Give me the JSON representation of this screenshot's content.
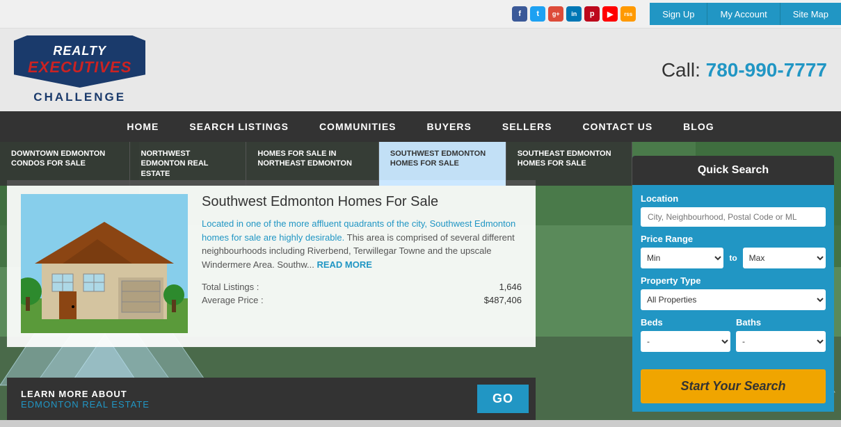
{
  "topbar": {
    "social": [
      {
        "name": "facebook",
        "label": "f",
        "class": "si-fb"
      },
      {
        "name": "twitter",
        "label": "t",
        "class": "si-tw"
      },
      {
        "name": "google-plus",
        "label": "g+",
        "class": "si-gp"
      },
      {
        "name": "linkedin",
        "label": "in",
        "class": "si-li"
      },
      {
        "name": "pinterest",
        "label": "p",
        "class": "si-pi"
      },
      {
        "name": "youtube",
        "label": "▶",
        "class": "si-yt"
      },
      {
        "name": "rss",
        "label": "rss",
        "class": "si-rss"
      }
    ],
    "links": [
      {
        "label": "Sign Up",
        "name": "sign-up"
      },
      {
        "label": "My Account",
        "name": "my-account"
      },
      {
        "label": "Site Map",
        "name": "site-map"
      }
    ]
  },
  "header": {
    "logo": {
      "line1": "REALTY",
      "line2": "EXECUTIVES",
      "line3": "CHALLENGE"
    },
    "call_label": "Call:",
    "call_number": "780-990-7777"
  },
  "nav": {
    "items": [
      {
        "label": "HOME",
        "name": "nav-home"
      },
      {
        "label": "SEARCH LISTINGS",
        "name": "nav-search-listings"
      },
      {
        "label": "COMMUNITIES",
        "name": "nav-communities"
      },
      {
        "label": "BUYERS",
        "name": "nav-buyers"
      },
      {
        "label": "SELLERS",
        "name": "nav-sellers"
      },
      {
        "label": "CONTACT US",
        "name": "nav-contact"
      },
      {
        "label": "BLOG",
        "name": "nav-blog"
      }
    ]
  },
  "subnav": {
    "items": [
      {
        "label": "DOWNTOWN EDMONTON CONDOS FOR SALE",
        "active": false,
        "name": "subnav-downtown"
      },
      {
        "label": "NORTHWEST EDMONTON REAL ESTATE",
        "active": false,
        "name": "subnav-northwest"
      },
      {
        "label": "HOMES FOR SALE IN NORTHEAST EDMONTON",
        "active": false,
        "name": "subnav-northeast"
      },
      {
        "label": "SOUTHWEST EDMONTON HOMES FOR SALE",
        "active": true,
        "name": "subnav-southwest"
      },
      {
        "label": "SOUTHEAST EDMONTON HOMES FOR SALE",
        "active": false,
        "name": "subnav-southeast"
      }
    ]
  },
  "listing": {
    "title": "Southwest Edmonton Homes For Sale",
    "description_blue": "Located in one of the more affluent quadrants of the city, Southwest Edmonton homes for sale are highly desirable.",
    "description_normal": "This area is comprised of several different neighbourhoods including Riverbend, Terwillegar Towne and the upscale Windermere Area. Southw...",
    "read_more": "READ MORE",
    "stats": [
      {
        "label": "Total Listings :",
        "value": "1,646"
      },
      {
        "label": "Average Price :",
        "value": "$487,406"
      }
    ],
    "cta": {
      "line1": "LEARN MORE ABOUT",
      "line2": "EDMONTON REAL ESTATE",
      "button": "GO"
    }
  },
  "quick_search": {
    "title": "Quick Search",
    "location_label": "Location",
    "location_placeholder": "City, Neighbourhood, Postal Code or ML",
    "price_label": "Price Range",
    "price_min": "Min",
    "price_max": "Max",
    "price_to": "to",
    "property_label": "Property Type",
    "property_default": "All Properties",
    "beds_label": "Beds",
    "baths_label": "Baths",
    "bed_default": "-",
    "bath_default": "-",
    "search_button": "Start Your Search"
  }
}
